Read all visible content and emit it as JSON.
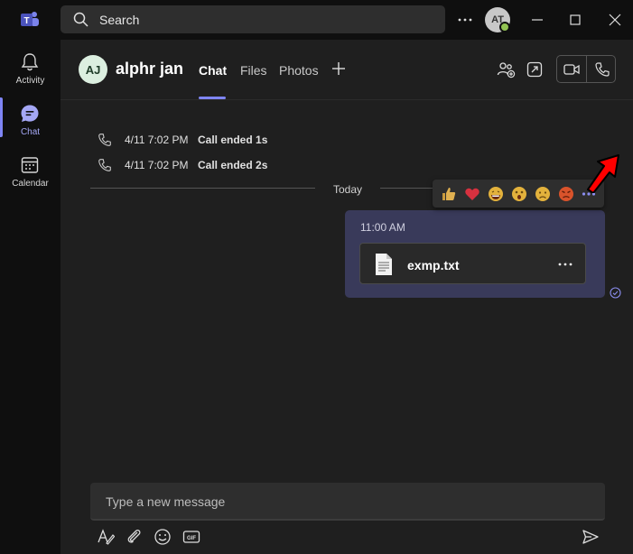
{
  "titlebar": {
    "search_placeholder": "Search",
    "user_initials": "AT"
  },
  "rail": {
    "items": [
      {
        "label": "Activity",
        "icon": "bell-icon"
      },
      {
        "label": "Chat",
        "icon": "chat-icon",
        "active": true
      },
      {
        "label": "Calendar",
        "icon": "calendar-icon"
      }
    ]
  },
  "header": {
    "avatar_initials": "AJ",
    "name": "alphr jan",
    "tabs": [
      {
        "label": "Chat",
        "active": true
      },
      {
        "label": "Files"
      },
      {
        "label": "Photos"
      }
    ]
  },
  "events": [
    {
      "time": "4/11 7:02 PM",
      "text": "Call ended",
      "duration": "1s"
    },
    {
      "time": "4/11 7:02 PM",
      "text": "Call ended",
      "duration": "2s"
    }
  ],
  "divider_label": "Today",
  "message": {
    "time": "11:00 AM",
    "file_name": "exmp.txt"
  },
  "reactions": [
    "like-icon",
    "heart-icon",
    "laugh-icon",
    "surprised-icon",
    "sad-icon",
    "angry-icon",
    "more-icon"
  ],
  "composer": {
    "placeholder": "Type a new message"
  },
  "colors": {
    "accent": "#7f85f5",
    "bubble": "#393a5a",
    "background": "#1f1f1f",
    "rail": "#0f0f0f",
    "arrow": "#ff0000"
  }
}
